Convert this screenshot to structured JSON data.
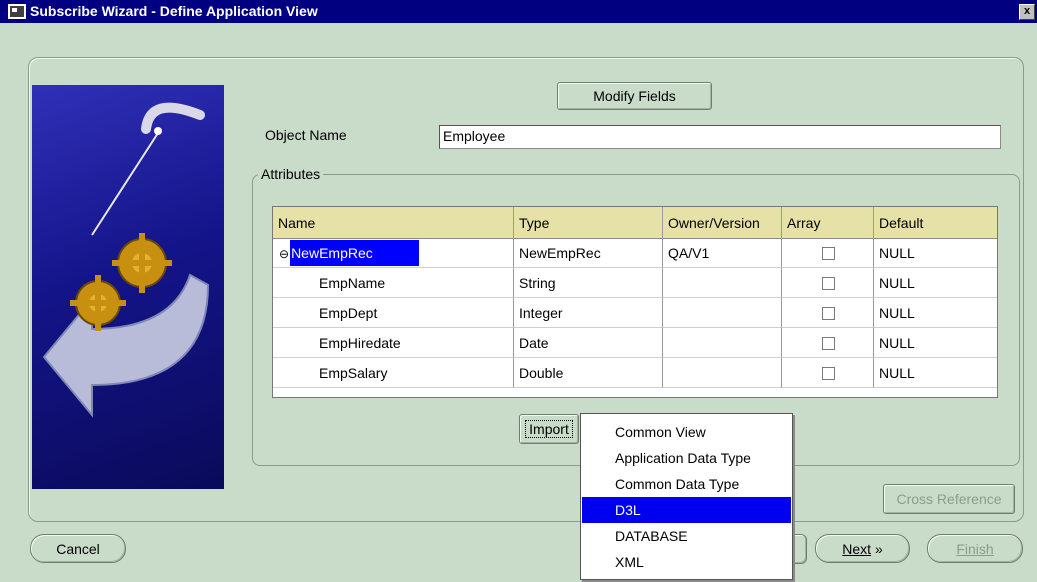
{
  "window": {
    "title": "Subscribe Wizard  - Define Application View",
    "close_label": "x"
  },
  "toolbar": {
    "modify_fields_label": "Modify Fields"
  },
  "object": {
    "label": "Object Name",
    "value": "Employee"
  },
  "attributes": {
    "group_label": "Attributes",
    "columns": [
      "Name",
      "Type",
      "Owner/Version",
      "Array",
      "Default"
    ],
    "rows": [
      {
        "name": "NewEmpRec",
        "type": "NewEmpRec",
        "owner": "QA/V1",
        "array": false,
        "default": "NULL",
        "expanded": true,
        "selected": true
      },
      {
        "name": "EmpName",
        "type": "String",
        "owner": "",
        "array": false,
        "default": "NULL"
      },
      {
        "name": "EmpDept",
        "type": "Integer",
        "owner": "",
        "array": false,
        "default": "NULL"
      },
      {
        "name": "EmpHiredate",
        "type": "Date",
        "owner": "",
        "array": false,
        "default": "NULL"
      },
      {
        "name": "EmpSalary",
        "type": "Double",
        "owner": "",
        "array": false,
        "default": "NULL"
      }
    ],
    "import_label": "Import"
  },
  "import_menu": {
    "items": [
      "Common View",
      "Application Data Type",
      "Common Data Type",
      "D3L",
      "DATABASE",
      "XML"
    ],
    "active_item": "D3L"
  },
  "buttons": {
    "cross_reference": "Cross Reference",
    "cancel": "Cancel",
    "next": "Next",
    "next_arrow": "»",
    "finish": "Finish"
  },
  "colors": {
    "background": "#c9dbc9",
    "title_bar": "#000080",
    "grid_header": "#e6e1a6",
    "selection": "#0000ff"
  }
}
